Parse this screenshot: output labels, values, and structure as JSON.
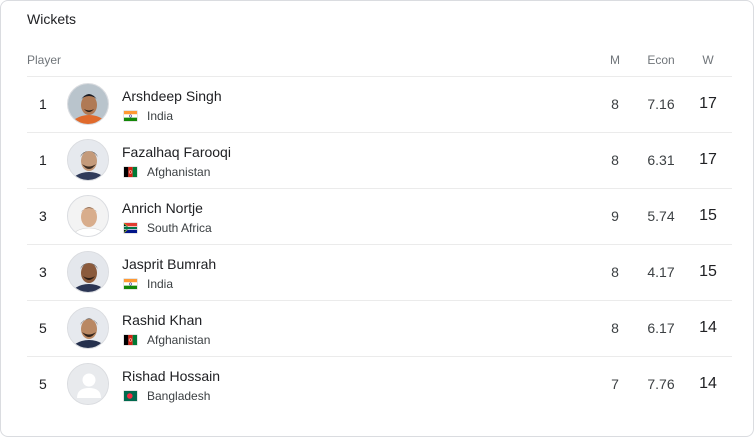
{
  "widget": {
    "title": "Wickets"
  },
  "table": {
    "headers": {
      "player": "Player",
      "matches": "M",
      "economy": "Econ",
      "wickets": "W"
    },
    "rows": [
      {
        "rank": "1",
        "name": "Arshdeep Singh",
        "country": "India",
        "flag": "india-flag-icon",
        "matches": "8",
        "economy": "7.16",
        "wickets": "17",
        "avatar": "player-photo"
      },
      {
        "rank": "1",
        "name": "Fazalhaq Farooqi",
        "country": "Afghanistan",
        "flag": "afghanistan-flag-icon",
        "matches": "8",
        "economy": "6.31",
        "wickets": "17",
        "avatar": "player-photo"
      },
      {
        "rank": "3",
        "name": "Anrich Nortje",
        "country": "South Africa",
        "flag": "south-africa-flag-icon",
        "matches": "9",
        "economy": "5.74",
        "wickets": "15",
        "avatar": "player-photo"
      },
      {
        "rank": "3",
        "name": "Jasprit Bumrah",
        "country": "India",
        "flag": "india-flag-icon",
        "matches": "8",
        "economy": "4.17",
        "wickets": "15",
        "avatar": "player-photo"
      },
      {
        "rank": "5",
        "name": "Rashid Khan",
        "country": "Afghanistan",
        "flag": "afghanistan-flag-icon",
        "matches": "8",
        "economy": "6.17",
        "wickets": "14",
        "avatar": "player-photo"
      },
      {
        "rank": "5",
        "name": "Rishad Hossain",
        "country": "Bangladesh",
        "flag": "bangladesh-flag-icon",
        "matches": "7",
        "economy": "7.76",
        "wickets": "14",
        "avatar": "placeholder-person-icon"
      }
    ]
  },
  "colors": {
    "text": "#202124",
    "secondary": "#70757a",
    "divider": "#ebebeb"
  }
}
